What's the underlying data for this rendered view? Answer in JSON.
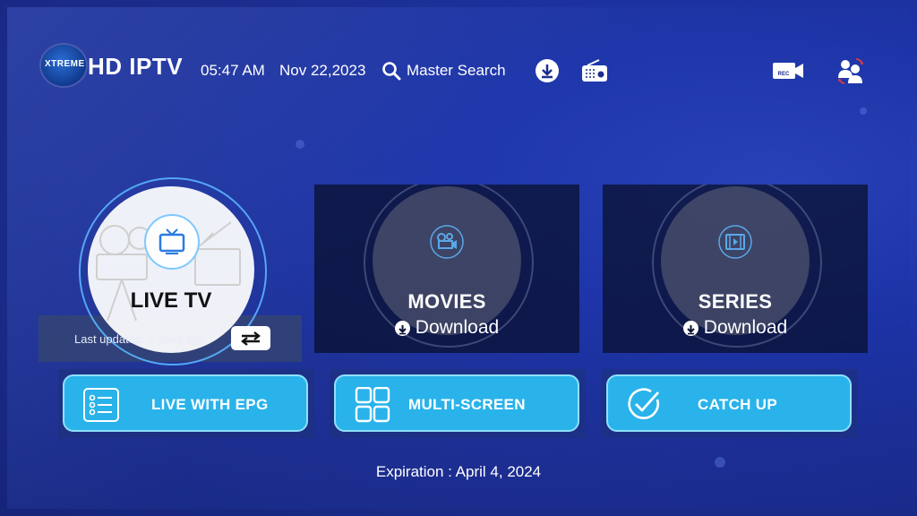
{
  "header": {
    "logo_text": "XTREME",
    "app_title": "HD IPTV",
    "time": "05:47 AM",
    "date": "Nov 22,2023",
    "search_label": "Master Search",
    "icons": [
      "download-icon",
      "radio-icon",
      "record-icon",
      "switch-user-icon"
    ]
  },
  "tiles": {
    "live_tv": {
      "label": "LIVE TV",
      "last_updated": "Last updated: 5 mins ago"
    },
    "movies": {
      "label": "MOVIES",
      "download": "Download"
    },
    "series": {
      "label": "SERIES",
      "download": "Download"
    }
  },
  "buttons": {
    "live_epg": "LIVE WITH EPG",
    "multi_screen": "MULTI-SCREEN",
    "catch_up": "CATCH UP"
  },
  "footer": {
    "expiration": "Expiration : April 4, 2024"
  },
  "colors": {
    "background": "#1c2d8f",
    "button": "#29b3ea",
    "focus_ring": "#5ab4ff"
  }
}
